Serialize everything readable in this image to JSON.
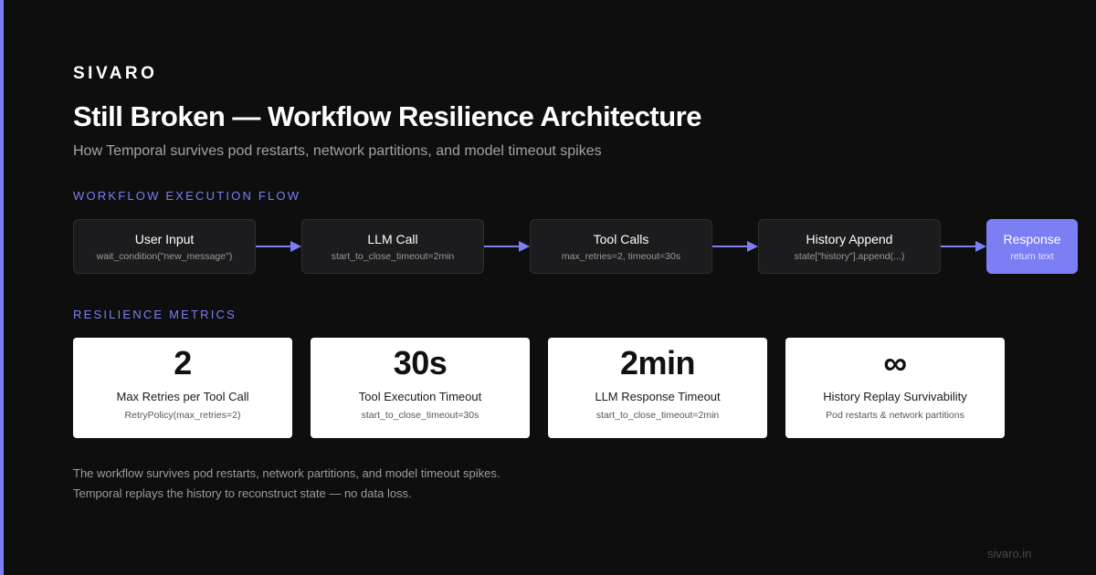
{
  "brand": "SIVARO",
  "title": "Still Broken — Workflow Resilience Architecture",
  "subtitle": "How Temporal survives pod restarts, network partitions, and model timeout spikes",
  "flow": {
    "label": "WORKFLOW EXECUTION FLOW",
    "steps": [
      {
        "title": "User Input",
        "sub": "wait_condition(\"new_message\")"
      },
      {
        "title": "LLM Call",
        "sub": "start_to_close_timeout=2min"
      },
      {
        "title": "Tool Calls",
        "sub": "max_retries=2, timeout=30s"
      },
      {
        "title": "History Append",
        "sub": "state[\"history\"].append(...)"
      },
      {
        "title": "Response",
        "sub": "return text"
      }
    ]
  },
  "metrics": {
    "label": "RESILIENCE METRICS",
    "cards": [
      {
        "value": "2",
        "label": "Max Retries per Tool Call",
        "sub": "RetryPolicy(max_retries=2)"
      },
      {
        "value": "30s",
        "label": "Tool Execution Timeout",
        "sub": "start_to_close_timeout=30s"
      },
      {
        "value": "2min",
        "label": "LLM Response Timeout",
        "sub": "start_to_close_timeout=2min"
      },
      {
        "value": "∞",
        "label": "History Replay Survivability",
        "sub": "Pod restarts & network partitions"
      }
    ]
  },
  "footnote": {
    "line1": "The workflow survives pod restarts, network partitions, and model timeout spikes.",
    "line2": "Temporal replays the history to reconstruct state — no data loss."
  },
  "site": "sivaro.in",
  "colors": {
    "background": "#0e0e0e",
    "accent": "#7c7ff4",
    "card": "#ffffff",
    "step": "#1c1c1e"
  }
}
